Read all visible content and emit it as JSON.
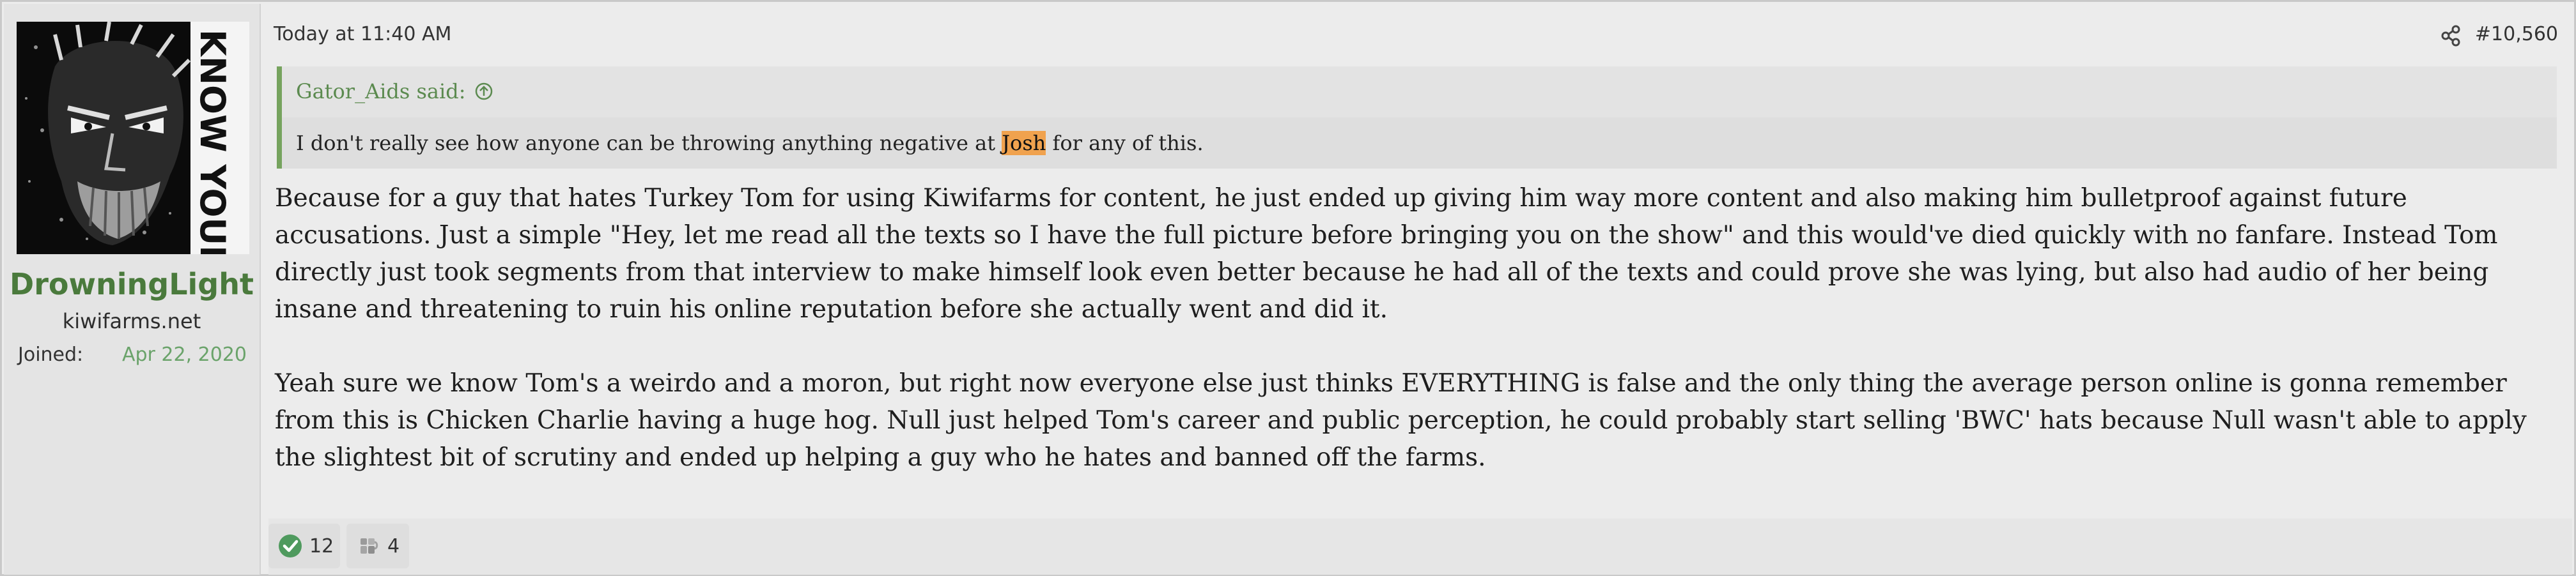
{
  "user": {
    "name": "DrowningLight",
    "title": "kiwifarms.net",
    "joined_label": "Joined:",
    "joined_date": "Apr 22, 2020",
    "avatar_banner": "KNOW YOUR PLACE."
  },
  "post": {
    "timestamp": "Today at 11:40 AM",
    "number": "#10,560",
    "quote": {
      "author_line": "Gator_Aids said:",
      "text_before": "I don't really see how anyone can be throwing anything negative at ",
      "highlight": "Josh",
      "text_after": " for any of this."
    },
    "paragraphs": [
      "Because for a guy that hates Turkey Tom for using Kiwifarms for content, he just ended up giving him way more content and also making him bulletproof against future accusations. Just a simple \"Hey, let me read all the texts so I have the full picture before bringing you on the show\" and this would've died quickly with no fanfare. Instead Tom directly just took segments from that interview to make himself look even better because he had all of the texts and could prove she was lying, but also had audio of her being insane and threatening to ruin his online reputation before she actually went and did it.",
      "Yeah sure we know Tom's a weirdo and a moron, but right now everyone else just thinks EVERYTHING is false and the only thing the average person online is gonna remember from this is Chicken Charlie having a huge hog. Null just helped Tom's career and public perception, he could probably start selling 'BWC' hats because Null wasn't able to apply the slightest bit of scrutiny and ended up helping a guy who he hates and banned off the farms."
    ],
    "reactions": [
      {
        "icon": "check-icon",
        "count": "12"
      },
      {
        "icon": "autism-icon",
        "count": "4"
      }
    ]
  },
  "colors": {
    "username": "#4a7a3c",
    "joined_date": "#6aa36a",
    "quote_border": "#76a35e",
    "highlight": "#f0a24e"
  }
}
